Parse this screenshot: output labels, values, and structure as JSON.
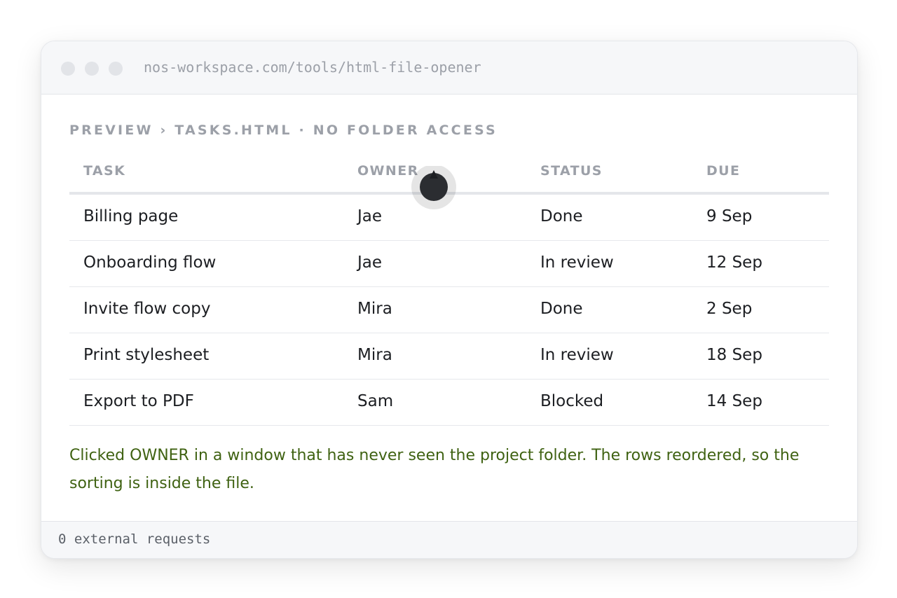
{
  "browser": {
    "url": "nos-workspace.com/tools/html-file-opener"
  },
  "breadcrumb": "PREVIEW › TASKS.HTML · NO FOLDER ACCESS",
  "table": {
    "headers": [
      "TASK",
      "OWNER",
      "STATUS",
      "DUE"
    ],
    "rows": [
      [
        "Billing page",
        "Jae",
        "Done",
        "9 Sep"
      ],
      [
        "Onboarding flow",
        "Jae",
        "In review",
        "12 Sep"
      ],
      [
        "Invite flow copy",
        "Mira",
        "Done",
        "2 Sep"
      ],
      [
        "Print stylesheet",
        "Mira",
        "In review",
        "18 Sep"
      ],
      [
        "Export to PDF",
        "Sam",
        "Blocked",
        "14 Sep"
      ]
    ],
    "sort": {
      "column": "OWNER",
      "direction": "ascending"
    }
  },
  "note": "Clicked OWNER in a window that has never seen the project folder. The rows reordered, so the sorting is inside the file.",
  "footer": "0 external requests",
  "colors": {
    "note_text": "#3f6212",
    "header_text": "#9ca0a8",
    "cursor": "#2b2d31"
  },
  "icons": [
    "window-dot",
    "sort-ascending-icon",
    "click-cursor-icon"
  ]
}
